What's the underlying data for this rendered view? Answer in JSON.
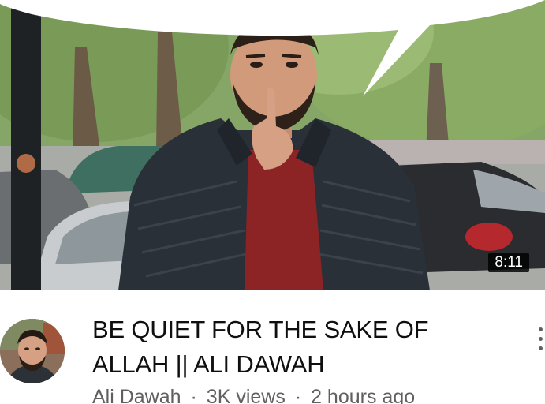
{
  "video": {
    "duration": "8:11",
    "title_line1": "BE QUIET FOR THE SAKE OF",
    "title_line2": "ALLAH || ALI DAWAH",
    "channel": "Ali Dawah",
    "separator": "·",
    "views": "3K views",
    "age": "2 hours ago"
  },
  "icons": {
    "more": "more-vert-icon"
  },
  "colors": {
    "title": "#0f0f0f",
    "meta": "#606060",
    "badge_bg": "#000000",
    "badge_text": "#ffffff"
  }
}
